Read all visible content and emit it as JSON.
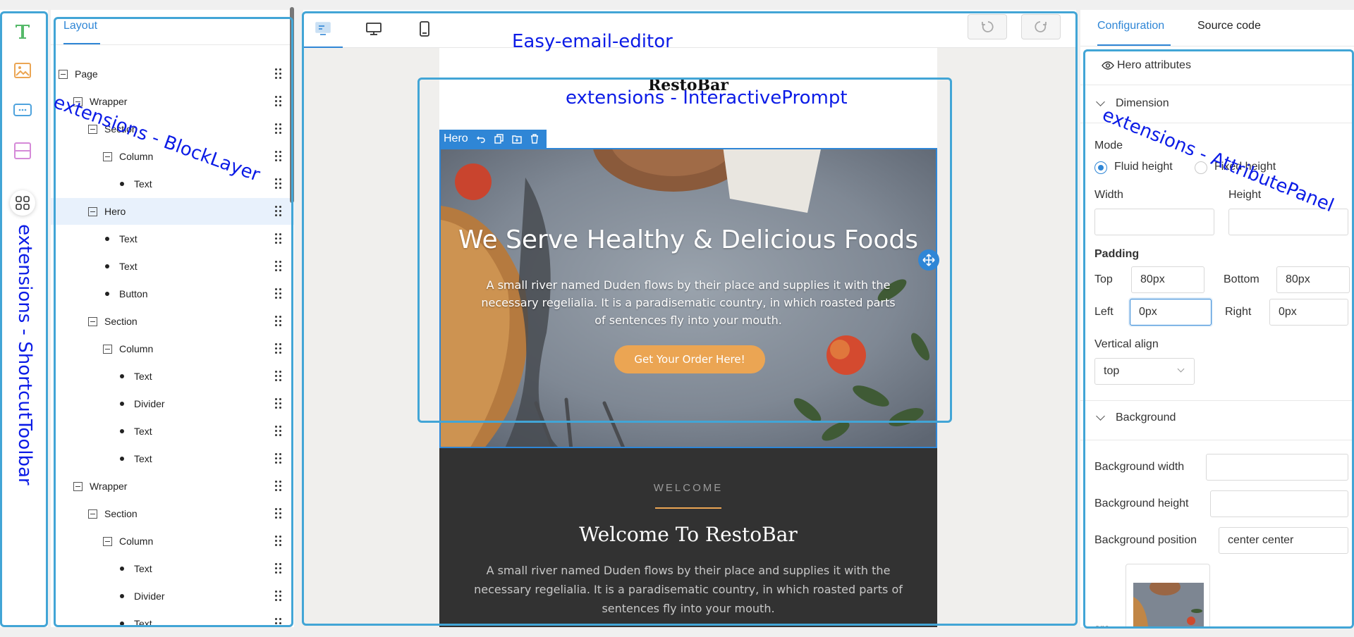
{
  "colors": {
    "annotation_border": "#42a5d6",
    "annotation_text": "#0b1be6",
    "accent": "#2f86d6",
    "hero_button": "#eba553",
    "welcome_bg": "#323232"
  },
  "annotations": {
    "shortcut_toolbar": "extensions - ShortcutToolbar",
    "block_layer": "extensions - BlockLayer",
    "editor": "Easy-email-editor",
    "interactive_prompt": "extensions - InteractivePrompt",
    "attribute_panel": "extensions - AttributePanel"
  },
  "shortcut_toolbar": {
    "icons": [
      "text-icon",
      "image-icon",
      "button-icon",
      "section-icon",
      "more-blocks-icon"
    ]
  },
  "block_layer": {
    "tab": "Layout",
    "tree": [
      {
        "label": "Page",
        "depth": 0,
        "kind": "toggle"
      },
      {
        "label": "Wrapper",
        "depth": 1,
        "kind": "toggle"
      },
      {
        "label": "Section",
        "depth": 2,
        "kind": "toggle"
      },
      {
        "label": "Column",
        "depth": 3,
        "kind": "toggle"
      },
      {
        "label": "Text",
        "depth": 4,
        "kind": "dot"
      },
      {
        "label": "Hero",
        "depth": 2,
        "kind": "toggle",
        "selected": true
      },
      {
        "label": "Text",
        "depth": 3,
        "kind": "dot"
      },
      {
        "label": "Text",
        "depth": 3,
        "kind": "dot"
      },
      {
        "label": "Button",
        "depth": 3,
        "kind": "dot"
      },
      {
        "label": "Section",
        "depth": 2,
        "kind": "toggle"
      },
      {
        "label": "Column",
        "depth": 3,
        "kind": "toggle"
      },
      {
        "label": "Text",
        "depth": 4,
        "kind": "dot"
      },
      {
        "label": "Divider",
        "depth": 4,
        "kind": "dot"
      },
      {
        "label": "Text",
        "depth": 4,
        "kind": "dot"
      },
      {
        "label": "Text",
        "depth": 4,
        "kind": "dot"
      },
      {
        "label": "Wrapper",
        "depth": 1,
        "kind": "toggle"
      },
      {
        "label": "Section",
        "depth": 2,
        "kind": "toggle"
      },
      {
        "label": "Column",
        "depth": 3,
        "kind": "toggle"
      },
      {
        "label": "Text",
        "depth": 4,
        "kind": "dot"
      },
      {
        "label": "Divider",
        "depth": 4,
        "kind": "dot"
      },
      {
        "label": "Text",
        "depth": 4,
        "kind": "dot"
      }
    ]
  },
  "editor": {
    "brand": "RestoBar",
    "hero_tag": "Hero",
    "hero": {
      "title": "We Serve Healthy & Delicious Foods",
      "text": "A small river named Duden flows by their place and supplies it with the necessary regelialia. It is a paradisematic country, in which roasted parts of sentences fly into your mouth.",
      "button": "Get Your Order Here!"
    },
    "welcome": {
      "kicker": "WELCOME",
      "title": "Welcome To RestoBar",
      "text": "A small river named Duden flows by their place and supplies it with the necessary regelialia. It is a paradisematic country, in which roasted parts of sentences fly into your mouth."
    }
  },
  "attribute_panel": {
    "tabs": [
      "Configuration",
      "Source code"
    ],
    "header": "Hero attributes",
    "dimension": {
      "title": "Dimension",
      "mode_label": "Mode",
      "mode_options": [
        "Fluid height",
        "Fixed height"
      ],
      "mode_selected": "Fluid height",
      "width_label": "Width",
      "height_label": "Height",
      "width_value": "",
      "height_value": "",
      "padding_label": "Padding",
      "top_label": "Top",
      "top_value": "80px",
      "bottom_label": "Bottom",
      "bottom_value": "80px",
      "left_label": "Left",
      "left_value": "0px",
      "right_label": "Right",
      "right_value": "0px",
      "valign_label": "Vertical align",
      "valign_value": "top"
    },
    "background": {
      "title": "Background",
      "width_label": "Background width",
      "width_value": "",
      "height_label": "Background height",
      "height_value": "",
      "position_label": "Background position",
      "position_value": "center center",
      "src_label": "src"
    }
  }
}
